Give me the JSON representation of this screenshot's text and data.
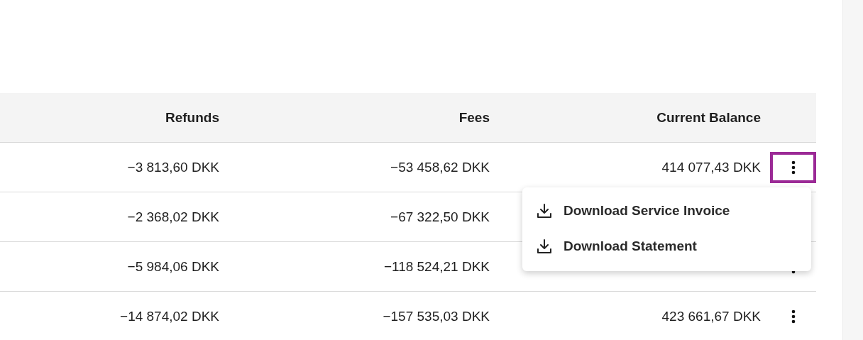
{
  "table": {
    "columns": [
      "Refunds",
      "Fees",
      "Current Balance"
    ],
    "rows": [
      {
        "refunds": "−3 813,60 DKK",
        "fees": "−53 458,62 DKK",
        "balance": "414 077,43 DKK",
        "menu_open": true
      },
      {
        "refunds": "−2 368,02 DKK",
        "fees": "−67 322,50 DKK",
        "menu_open": false
      },
      {
        "refunds": "−5 984,06 DKK",
        "fees": "−118 524,21 DKK",
        "menu_open": false
      },
      {
        "refunds": "−14 874,02 DKK",
        "fees": "−157 535,03 DKK",
        "balance": "423 661,67 DKK",
        "menu_open": false
      }
    ]
  },
  "menu": {
    "items": [
      "Download Service Invoice",
      "Download Statement"
    ]
  }
}
